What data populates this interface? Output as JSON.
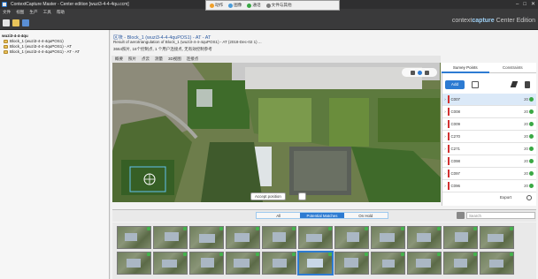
{
  "window": {
    "title": "ContextCapture Master - Center edition [wuzi3-4-4-4qu.ccm]",
    "controls": [
      "–",
      "□",
      "✕"
    ]
  },
  "floatbar": {
    "items": [
      "动作",
      "图像",
      "通话",
      "文件与其他"
    ]
  },
  "menu": [
    "文件",
    "视图",
    "生产",
    "工具",
    "帮助"
  ],
  "brand": {
    "prefix": "context",
    "strong": "capture",
    "edition": "Center Edition"
  },
  "tree": {
    "root": "wuzi3-4-4-4qu",
    "items": [
      "Block_1 (wuzi3-4-4-4quPOS1)",
      "Block_1 (wuzi3-4-4-4quPOS1) - AT",
      "Block_1 (wuzi3-4-4-4quPOS1) - AT - AT"
    ]
  },
  "header": {
    "title": "区块 - Block_1 (wuzi3-4-4-4quPOS1) - AT - AT",
    "line1": "Result of aerotriangulation of Block_1 (wuzi3-4-4-4quPOS1) - AT (2018-Dec-02 1) ...",
    "line2": "3664照片, 16个控制点, 1 个用户连接点, 无有效控制参考"
  },
  "subtabs": [
    "概要",
    "照片",
    "点云",
    "测量",
    "3D视图",
    "连接点"
  ],
  "photo": {
    "button_label": "Accept position"
  },
  "right_panel": {
    "tabs": [
      "Survey Points",
      "Constraints"
    ],
    "add_label": "Add",
    "points": [
      {
        "name": "C007",
        "count": "20"
      },
      {
        "name": "C008",
        "count": "20"
      },
      {
        "name": "C009",
        "count": "20"
      },
      {
        "name": "C270",
        "count": "20"
      },
      {
        "name": "C271",
        "count": "20"
      },
      {
        "name": "C098",
        "count": "20"
      },
      {
        "name": "C097",
        "count": "20"
      },
      {
        "name": "C096",
        "count": "20"
      }
    ],
    "export_label": "Export"
  },
  "filter": {
    "buttons": [
      "All",
      "Potential Matches",
      "On Hold"
    ],
    "active_index": 1,
    "search_placeholder": "Search"
  },
  "colors": {
    "accent": "#2d7bd2",
    "ok": "#3aa845",
    "point_marker": "#d23232"
  }
}
